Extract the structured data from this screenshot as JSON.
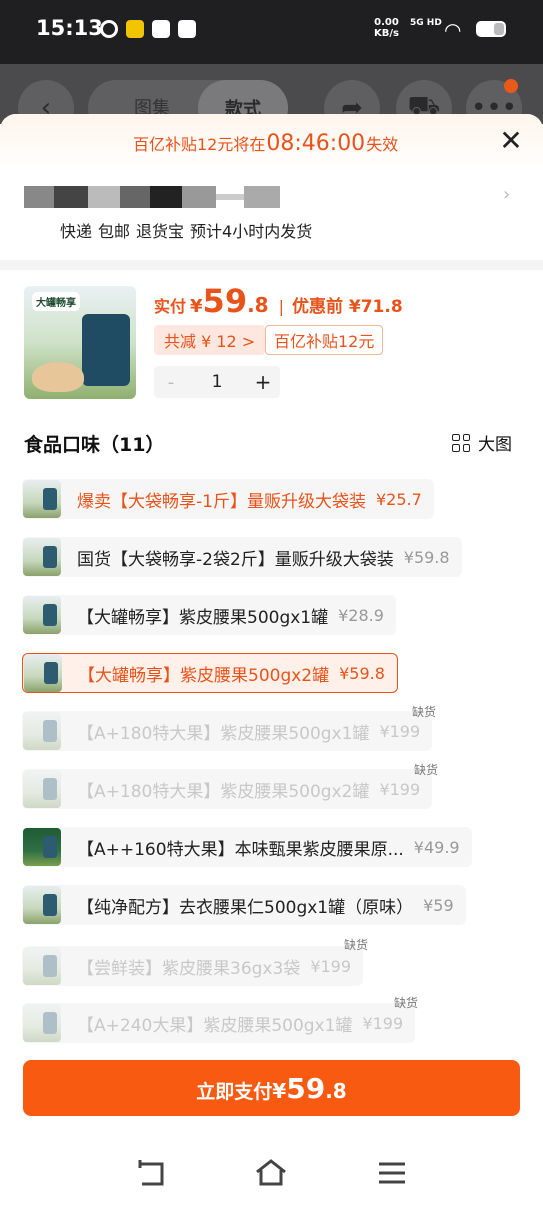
{
  "status_bar": {
    "time": "15:13",
    "net_speed": "0.00",
    "net_unit": "KB/s",
    "signal": "5G HD"
  },
  "bg": {
    "tab_gallery": "图集",
    "tab_style": "款式"
  },
  "countdown": {
    "prefix": "百亿补贴12元将在",
    "clock": "08:46:00",
    "suffix": "失效"
  },
  "delivery": [
    "快递",
    "包邮",
    "退货宝",
    "预计4小时内发货"
  ],
  "product": {
    "image_label": "大罐畅享",
    "pay_label": "实付",
    "currency": "¥",
    "price_int": "59",
    "price_dec": ".8",
    "orig_label": "优惠前 ¥71.8",
    "discount_chip": "共减 ¥ 12 >",
    "subsidy_chip": "百亿补贴12元",
    "qty_minus": "-",
    "qty": "1",
    "qty_plus": "+"
  },
  "flavor": {
    "title": "食品口味（11）",
    "big_view": "大图"
  },
  "options": [
    {
      "name": "爆卖【大袋畅享-1斤】量贩升级大袋装",
      "price": "¥25.7",
      "state": "hot"
    },
    {
      "name": "国货【大袋畅享-2袋2斤】量贩升级大袋装",
      "price": "¥59.8",
      "state": "normal"
    },
    {
      "name": "【大罐畅享】紫皮腰果500gx1罐",
      "price": "¥28.9",
      "state": "normal"
    },
    {
      "name": "【大罐畅享】紫皮腰果500gx2罐",
      "price": "¥59.8",
      "state": "selected"
    },
    {
      "name": "【A+180特大果】紫皮腰果500gx1罐",
      "price": "¥199",
      "state": "disabled",
      "badge": "缺货"
    },
    {
      "name": "【A+180特大果】紫皮腰果500gx2罐",
      "price": "¥199",
      "state": "disabled",
      "badge": "缺货"
    },
    {
      "name": "【A++160特大果】本味甄果紫皮腰果原...",
      "price": "¥49.9",
      "state": "normal"
    },
    {
      "name": "【纯净配方】去衣腰果仁500gx1罐（原味）",
      "price": "¥59",
      "state": "normal"
    },
    {
      "name": "【尝鲜装】紫皮腰果36gx3袋",
      "price": "¥199",
      "state": "disabled",
      "badge": "缺货"
    },
    {
      "name": "【A+240大果】紫皮腰果500gx1罐",
      "price": "¥199",
      "state": "disabled",
      "badge": "缺货"
    }
  ],
  "pay_button": {
    "label": "立即支付",
    "currency": "¥",
    "int": "59",
    "dec": ".8"
  },
  "icons": {
    "back": "chevron-left-icon",
    "share": "share-icon",
    "cart": "cart-icon",
    "more": "more-icon",
    "close": "close-icon",
    "nav": [
      "back-nav-icon",
      "home-nav-icon",
      "menu-nav-icon"
    ]
  },
  "colors": {
    "accent": "#e9531a",
    "pay_button": "#f85a12",
    "disabled_text": "#c8c8c8"
  }
}
